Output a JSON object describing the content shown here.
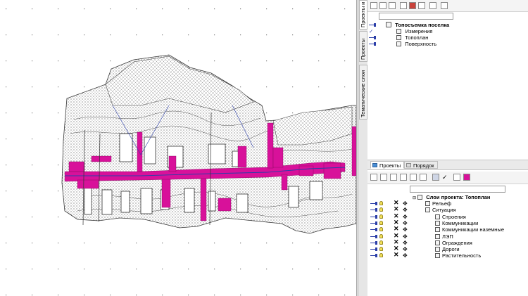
{
  "side_tabs": [
    "Проекты и сл",
    "Проекты",
    "Тематические слои"
  ],
  "upper_tree": {
    "root_label": "Топосъемка поселка",
    "items": [
      {
        "label": "Измерения"
      },
      {
        "label": "Топоплан"
      },
      {
        "label": "Поверхность"
      }
    ]
  },
  "bottom_tabs": [
    "Проекты",
    "Порядок"
  ],
  "layers_tree": {
    "root_label": "Слои проекта: Топоплан",
    "items": [
      {
        "label": "Рельеф",
        "level": 1
      },
      {
        "label": "Ситуация",
        "level": 1
      },
      {
        "label": "Строения",
        "level": 2
      },
      {
        "label": "Коммуникации",
        "level": 2
      },
      {
        "label": "Коммуникации наземные",
        "level": 2
      },
      {
        "label": "ЛЭП",
        "level": 2
      },
      {
        "label": "Ограждения",
        "level": 2
      },
      {
        "label": "Дороги",
        "level": 2
      },
      {
        "label": "Растительность",
        "level": 2
      }
    ]
  },
  "colors": {
    "magenta": "#d8119a",
    "accent_blue": "#2b3ea8",
    "hatch": "#555555"
  }
}
